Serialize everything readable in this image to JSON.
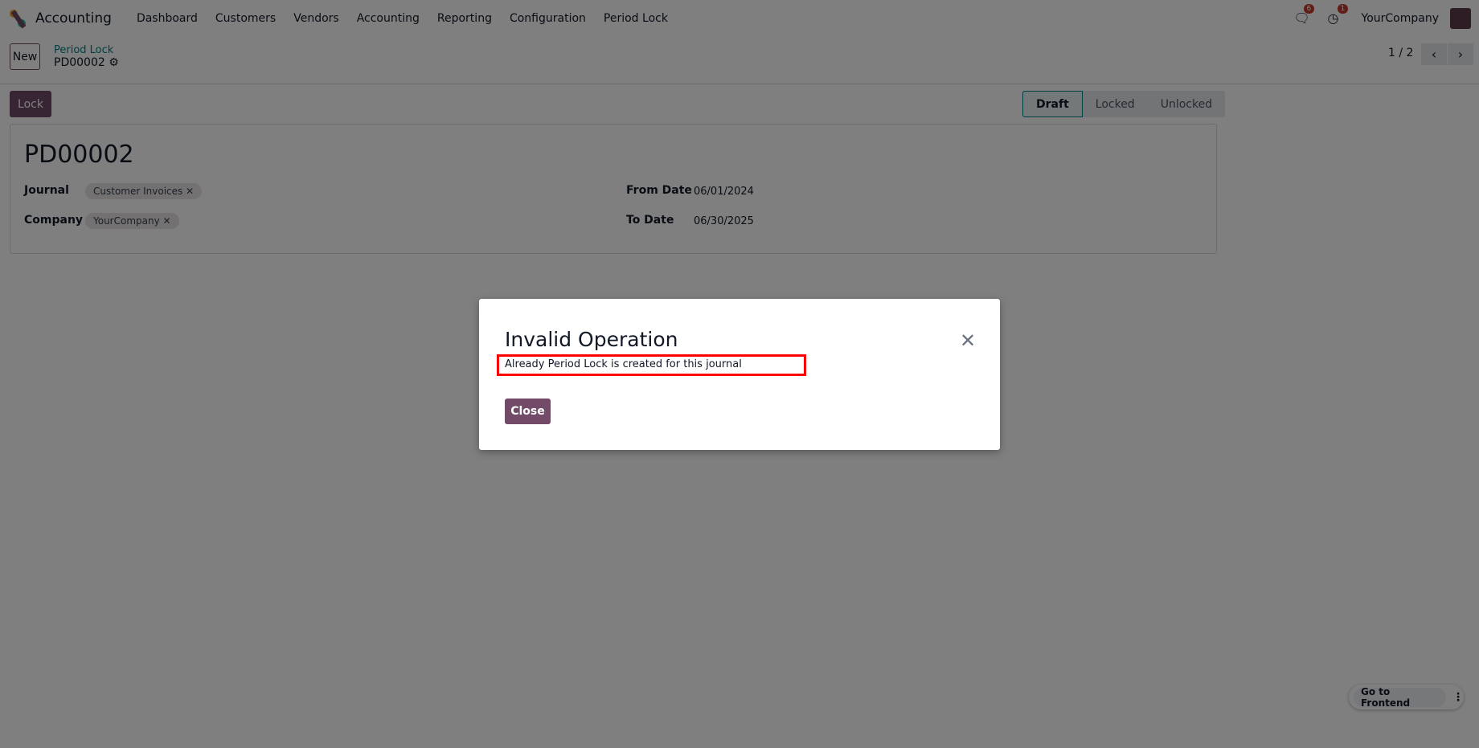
{
  "navbar": {
    "app": "Accounting",
    "menus": [
      "Dashboard",
      "Customers",
      "Vendors",
      "Accounting",
      "Reporting",
      "Configuration",
      "Period Lock"
    ],
    "messages_count": "6",
    "activities_count": "1",
    "company": "YourCompany"
  },
  "control": {
    "new_label": "New",
    "breadcrumb_parent": "Period Lock",
    "breadcrumb_current": "PD00002",
    "pager": "1 / 2"
  },
  "actions": {
    "lock_label": "Lock"
  },
  "statusbar": [
    "Draft",
    "Locked",
    "Unlocked"
  ],
  "form": {
    "title": "PD00002",
    "journal_label": "Journal",
    "journal_tag": "Customer Invoices",
    "company_label": "Company",
    "company_tag": "YourCompany",
    "from_label": "From Date",
    "from_value": "06/01/2024",
    "to_label": "To Date",
    "to_value": "06/30/2025"
  },
  "frontend": {
    "label": "Go to Frontend"
  },
  "dialog": {
    "title": "Invalid Operation",
    "message": "Already Period Lock is created for this journal",
    "close_label": "Close"
  }
}
